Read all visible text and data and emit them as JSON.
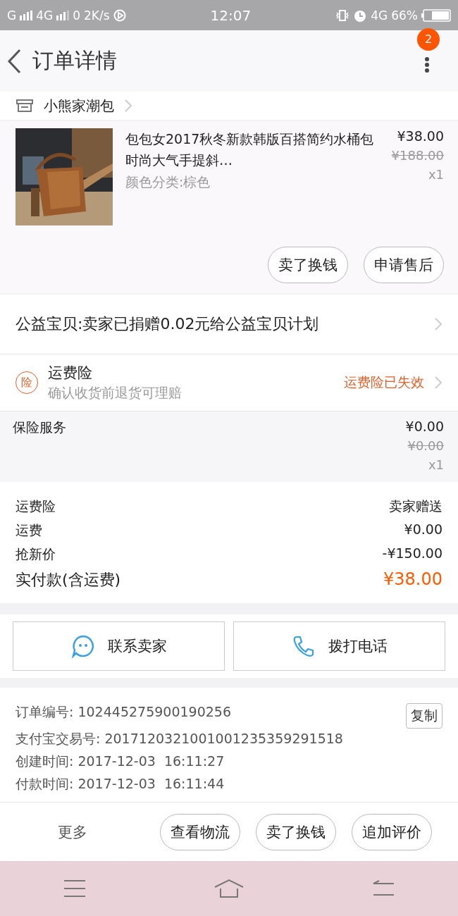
{
  "status_bar": {
    "carrier_1": "G",
    "carrier_2": "4G",
    "speed_count": "0",
    "speed": "2K/s",
    "time": "12:07",
    "network": "4G",
    "battery": "66%"
  },
  "header": {
    "title": "订单详情",
    "badge": "2"
  },
  "shop": {
    "name": "小熊家潮包"
  },
  "product": {
    "title": "包包女2017秋冬新款韩版百搭简约水桶包时尚大气手提斜…",
    "variant": "颜色分类:棕色",
    "price": "¥38.00",
    "original_price": "¥188.00",
    "quantity": "x1",
    "buttons": [
      "卖了换钱",
      "申请售后"
    ]
  },
  "charity": {
    "text": "公益宝贝:卖家已捐赠0.02元给公益宝贝计划"
  },
  "insurance": {
    "icon_label": "险",
    "title": "运费险",
    "subtitle": "确认收货前退货可理赔",
    "status": "运费险已失效"
  },
  "service": {
    "name": "保险服务",
    "price": "¥0.00",
    "original_price": "¥0.00",
    "quantity": "x1"
  },
  "costs": [
    {
      "label": "运费险",
      "value": "卖家赠送",
      "kind": "plain"
    },
    {
      "label": "运费",
      "value": "¥0.00",
      "kind": "plain"
    },
    {
      "label": "抢新价",
      "value": "-¥150.00",
      "kind": "plain"
    },
    {
      "label": "实付款(含运费)",
      "value": "¥38.00",
      "kind": "total"
    }
  ],
  "contact": [
    {
      "label": "联系卖家",
      "kind": "chat"
    },
    {
      "label": "拨打电话",
      "kind": "phone"
    }
  ],
  "order_info": {
    "copy_button": "复制",
    "lines": [
      "订单编号: 102445275900190256",
      "支付宝交易号: 2017120321001001235359291518",
      "创建时间: 2017-12-03  16:11:27",
      "付款时间: 2017-12-03  16:11:44"
    ]
  },
  "bottom_bar": {
    "more": "更多",
    "buttons": [
      "查看物流",
      "卖了换钱",
      "追加评价"
    ]
  }
}
